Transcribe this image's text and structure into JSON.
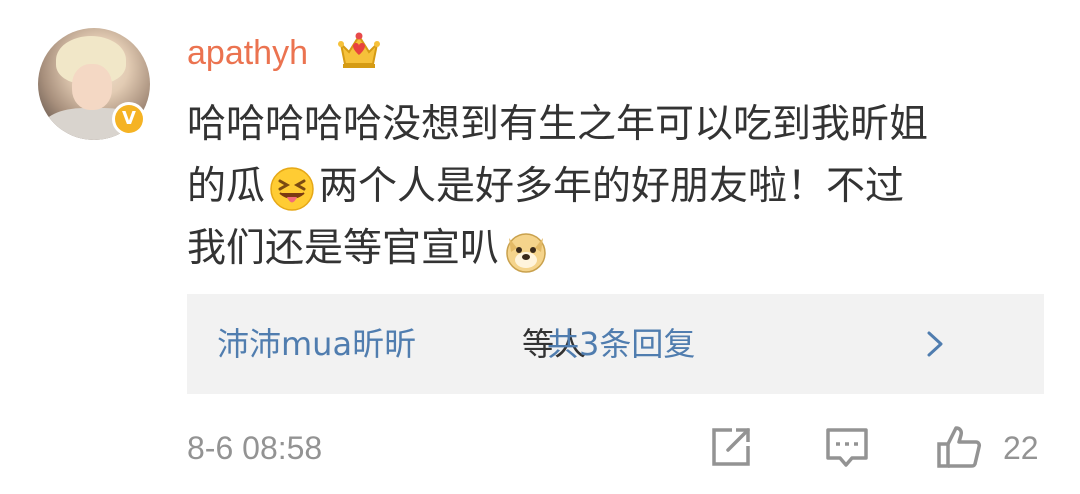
{
  "comment": {
    "avatar_icon": "user-avatar",
    "verified_icon": "verified-v-badge-icon",
    "verified_letter": "V",
    "username": "apathyh",
    "vip_icon": "vip-crown-icon",
    "content_lines": [
      "哈哈哈哈哈没想到有生之年可以吃到我昕姐",
      "的瓜",
      "两个人是好多年的好朋友啦！不过",
      "我们还是等官宣叭"
    ],
    "emoji_1": "laughing-tongue-emoji",
    "emoji_2": "doge-emoji",
    "replies": {
      "names": "沛沛mua昕昕",
      "suffix": "等人",
      "count_text": "共3条回复",
      "chevron_icon": "chevron-right-icon"
    },
    "timestamp": "8-6 08:58",
    "actions": {
      "share_icon": "share-edit-icon",
      "comment_icon": "comment-icon",
      "like_icon": "thumbs-up-icon",
      "like_count": "22"
    },
    "colors": {
      "username": "#eb7350",
      "link": "#507daf",
      "text": "#333333",
      "meta": "#939393",
      "reply_bg": "#f2f2f2",
      "badge": "#f5b324"
    }
  }
}
